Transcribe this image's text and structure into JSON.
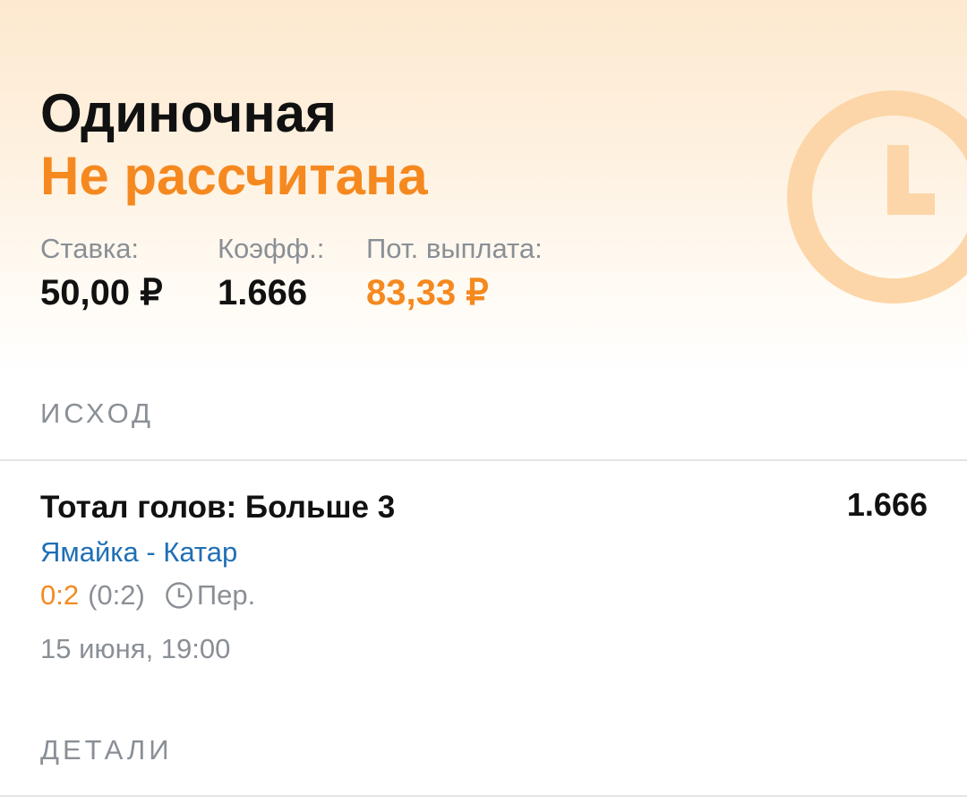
{
  "bet": {
    "type": "Одиночная",
    "status": "Не рассчитана"
  },
  "stats": [
    {
      "label": "Ставка:",
      "value": "50,00 ₽"
    },
    {
      "label": "Коэфф.:",
      "value": "1.666"
    },
    {
      "label": "Пот. выплата:",
      "value": "83,33 ₽"
    }
  ],
  "outcome_section": {
    "label": "ИСХОД",
    "market": "Тотал голов: Больше 3",
    "odds": "1.666",
    "teams": "Ямайка - Катар",
    "score": "0:2",
    "half_score": "(0:2)",
    "period": "Пер.",
    "date": "15 июня, 19:00"
  },
  "details_section": {
    "label": "ДЕТАЛИ"
  },
  "icons": {
    "status": "clock-icon",
    "period": "clock-icon"
  },
  "colors": {
    "accent": "#f5891f",
    "link": "#1f6fb5",
    "muted": "#8a8f96",
    "text": "#111111",
    "header_tint": "#fde9cf"
  }
}
